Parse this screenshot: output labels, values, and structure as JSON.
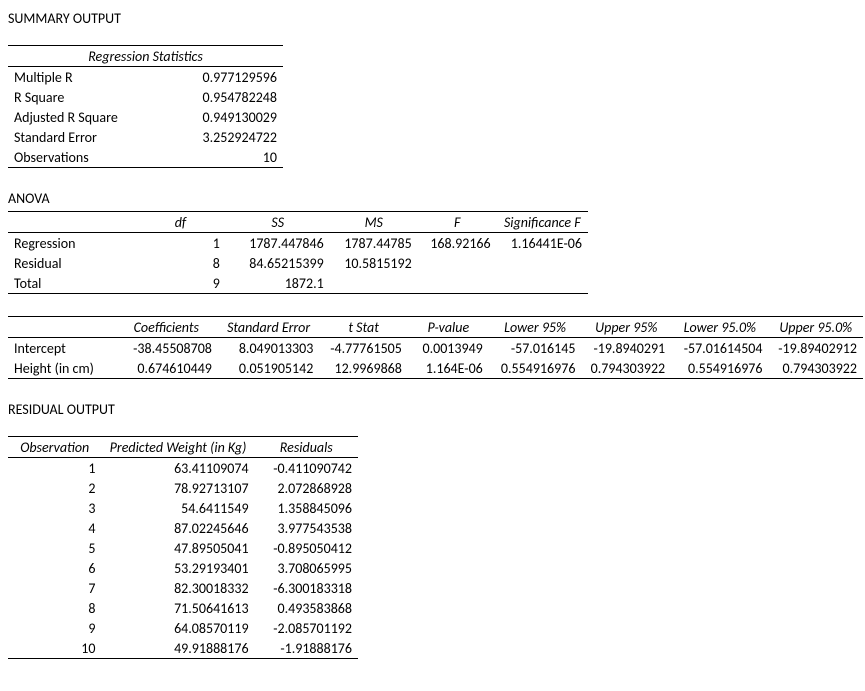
{
  "titles": {
    "summary": "SUMMARY OUTPUT",
    "anova": "ANOVA",
    "residual": "RESIDUAL OUTPUT"
  },
  "reg_stats": {
    "header": "Regression Statistics",
    "rows": [
      {
        "label": "Multiple R",
        "value": "0.977129596"
      },
      {
        "label": "R Square",
        "value": "0.954782248"
      },
      {
        "label": "Adjusted R Square",
        "value": "0.949130029"
      },
      {
        "label": "Standard Error",
        "value": "3.252924722"
      },
      {
        "label": "Observations",
        "value": "10"
      }
    ]
  },
  "anova": {
    "headers": {
      "df": "df",
      "ss": "SS",
      "ms": "MS",
      "f": "F",
      "sigf": "Significance F"
    },
    "rows": [
      {
        "label": "Regression",
        "df": "1",
        "ss": "1787.447846",
        "ms": "1787.44785",
        "f": "168.92166",
        "sigf": "1.16441E-06"
      },
      {
        "label": "Residual",
        "df": "8",
        "ss": "84.65215399",
        "ms": "10.5815192",
        "f": "",
        "sigf": ""
      },
      {
        "label": "Total",
        "df": "9",
        "ss": "1872.1",
        "ms": "",
        "f": "",
        "sigf": ""
      }
    ]
  },
  "coeffs": {
    "headers": {
      "coef": "Coefficients",
      "se": "Standard Error",
      "t": "t Stat",
      "p": "P-value",
      "l95": "Lower 95%",
      "u95": "Upper 95%",
      "l950": "Lower 95.0%",
      "u950": "Upper 95.0%"
    },
    "rows": [
      {
        "label": "Intercept",
        "coef": "-38.45508708",
        "se": "8.049013303",
        "t": "-4.77761505",
        "p": "0.0013949",
        "l95": "-57.016145",
        "u95": "-19.8940291",
        "l950": "-57.01614504",
        "u950": "-19.89402912"
      },
      {
        "label": "Height (in cm)",
        "coef": "0.674610449",
        "se": "0.051905142",
        "t": "12.9969868",
        "p": "1.164E-06",
        "l95": "0.554916976",
        "u95": "0.794303922",
        "l950": "0.554916976",
        "u950": "0.794303922"
      }
    ]
  },
  "resid": {
    "headers": {
      "obs": "Observation",
      "pred": "Predicted Weight (in Kg)",
      "res": "Residuals"
    },
    "rows": [
      {
        "obs": "1",
        "pred": "63.41109074",
        "res": "-0.411090742"
      },
      {
        "obs": "2",
        "pred": "78.92713107",
        "res": "2.072868928"
      },
      {
        "obs": "3",
        "pred": "54.6411549",
        "res": "1.358845096"
      },
      {
        "obs": "4",
        "pred": "87.02245646",
        "res": "3.977543538"
      },
      {
        "obs": "5",
        "pred": "47.89505041",
        "res": "-0.895050412"
      },
      {
        "obs": "6",
        "pred": "53.29193401",
        "res": "3.708065995"
      },
      {
        "obs": "7",
        "pred": "82.30018332",
        "res": "-6.300183318"
      },
      {
        "obs": "8",
        "pred": "71.50641613",
        "res": "0.493583868"
      },
      {
        "obs": "9",
        "pred": "64.08570119",
        "res": "-2.085701192"
      },
      {
        "obs": "10",
        "pred": "49.91888176",
        "res": "-1.91888176"
      }
    ]
  }
}
